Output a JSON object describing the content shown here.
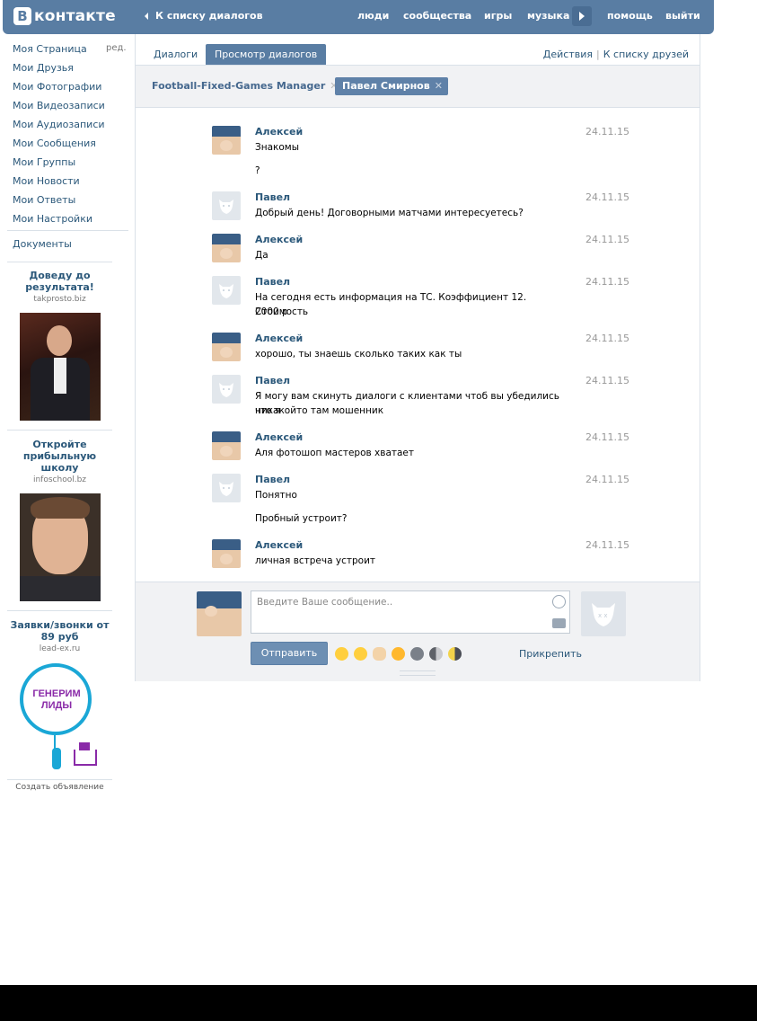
{
  "header": {
    "logo_letter": "В",
    "logo_text": "контакте",
    "back_link": "К списку диалогов",
    "nav": [
      "люди",
      "сообщества",
      "игры",
      "музыка",
      "помощь",
      "выйти"
    ]
  },
  "left_menu": {
    "items": [
      "Моя Страница",
      "Мои Друзья",
      "Мои Фотографии",
      "Мои Видеозаписи",
      "Мои Аудиозаписи",
      "Мои Сообщения",
      "Мои Группы",
      "Мои Новости",
      "Мои Ответы",
      "Мои Настройки"
    ],
    "edit": "ред.",
    "documents": "Документы"
  },
  "ads": [
    {
      "title": "Доведу до результата!",
      "domain": "takprosto.biz"
    },
    {
      "title": "Откройте прибыльную школу",
      "domain": "infoschool.bz"
    },
    {
      "title": "Заявки/звонки от 89 руб",
      "domain": "lead-ex.ru",
      "banner_text": "ГЕНЕРИМ ЛИДЫ"
    }
  ],
  "create_ad": "Создать объявление",
  "tabs": {
    "dialogs": "Диалоги",
    "view": "Просмотр диалогов",
    "actions": "Действия",
    "to_friends": "К списку друзей"
  },
  "participants": [
    "Football-Fixed-Games Manager",
    "Павел Смирнов"
  ],
  "messages": [
    {
      "author": "Алексей",
      "date": "24.11.15",
      "lines": [
        "Знакомы",
        "",
        "?"
      ],
      "avatar": "kid"
    },
    {
      "author": "Павел",
      "date": "24.11.15",
      "lines": [
        "Добрый день! Договорными матчами интересуетесь?"
      ],
      "avatar": "dog"
    },
    {
      "author": "Алексей",
      "date": "24.11.15",
      "lines": [
        "Да"
      ],
      "avatar": "kid"
    },
    {
      "author": "Павел",
      "date": "24.11.15",
      "lines": [
        "На сегодня есть информация на ТС. Коэффициент 12. Стоимость",
        "2000 р"
      ],
      "avatar": "dog"
    },
    {
      "author": "Алексей",
      "date": "24.11.15",
      "lines": [
        "хорошо, ты знаешь сколько таких как ты"
      ],
      "avatar": "kid"
    },
    {
      "author": "Павел",
      "date": "24.11.15",
      "lines": [
        "Я могу вам скинуть диалоги с клиентами чтоб вы убедились что я",
        "никакойто там мошенник"
      ],
      "avatar": "dog"
    },
    {
      "author": "Алексей",
      "date": "24.11.15",
      "lines": [
        "Аля фотошоп мастеров хватает"
      ],
      "avatar": "kid"
    },
    {
      "author": "Павел",
      "date": "24.11.15",
      "lines": [
        "Понятно",
        "",
        "Пробный устроит?"
      ],
      "avatar": "dog"
    },
    {
      "author": "Алексей",
      "date": "24.11.15",
      "lines": [
        "личная встреча устроит"
      ],
      "avatar": "kid"
    }
  ],
  "compose": {
    "placeholder": "Введите Ваше сообщение..",
    "send": "Отправить",
    "attach": "Прикрепить"
  },
  "colors": {
    "brand": "#597da3",
    "link": "#2b587a",
    "panel_bg": "#f1f2f4"
  }
}
